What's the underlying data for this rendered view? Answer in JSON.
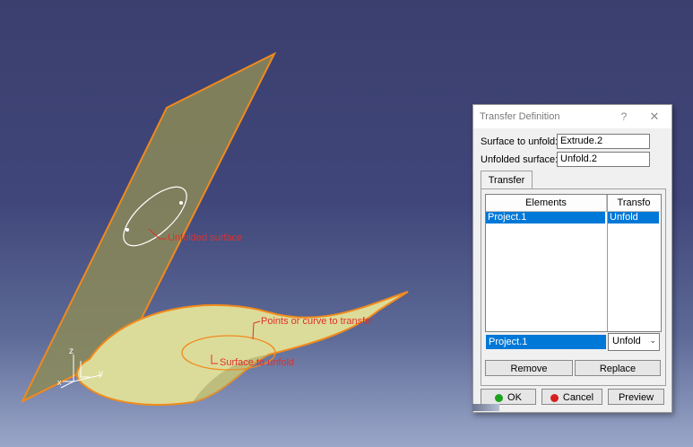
{
  "viewport": {
    "annotations": {
      "unfolded_surface": "Unfolded surface",
      "points_to_transfer": "Points or curve to transfer",
      "surface_to_unfold": "Surface to unfold"
    },
    "axes": {
      "z": "z",
      "y": "y",
      "x": "x"
    }
  },
  "dialog": {
    "title": "Transfer Definition",
    "help_glyph": "?",
    "close_glyph": "✕",
    "surface_to_unfold_label": "Surface to unfold:",
    "surface_to_unfold_value": "Extrude.2",
    "unfolded_surface_label": "Unfolded surface:",
    "unfolded_surface_value": "Unfold.2",
    "tab_label": "Transfer",
    "table": {
      "columns": [
        "Elements",
        "Transfo"
      ],
      "rows": [
        {
          "element": "Project.1",
          "transfo": "Unfold"
        }
      ]
    },
    "selected_element": "Project.1",
    "transfo_combo_value": "Unfold",
    "combo_arrow": "⌄",
    "remove_label": "Remove",
    "replace_label": "Replace",
    "ok_label": "OK",
    "cancel_label": "Cancel",
    "preview_label": "Preview",
    "colors": {
      "selection": "#0078d7",
      "ok_dot": "#1ea21e",
      "cancel_dot": "#d42020",
      "annotation": "#e0302a",
      "surface_edge": "#f08a1c"
    }
  }
}
